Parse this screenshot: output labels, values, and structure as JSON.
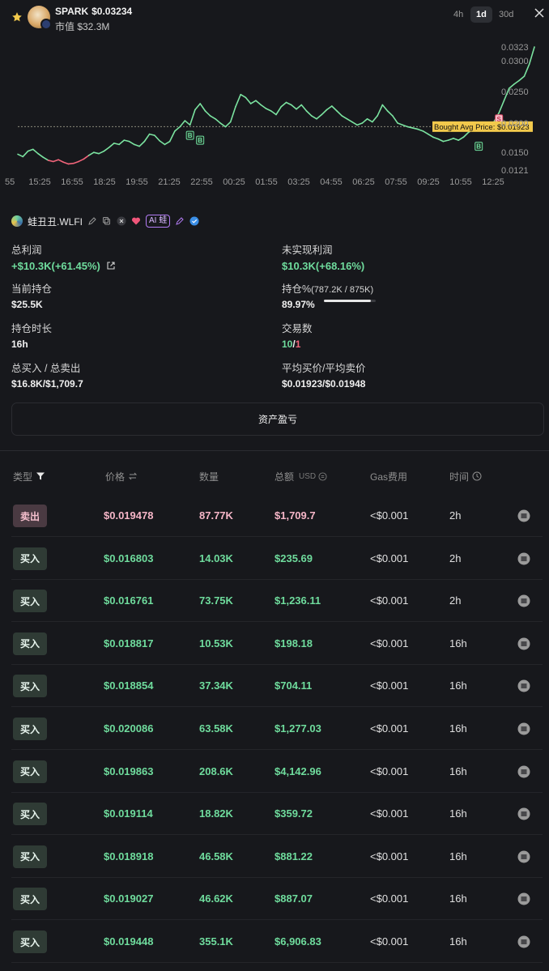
{
  "header": {
    "symbol": "SPARK",
    "price": "$0.03234",
    "mcap": "市值 $32.3M",
    "timeframes": [
      "4h",
      "1d",
      "30d"
    ],
    "active_timeframe": "1d"
  },
  "chart_data": {
    "type": "line",
    "x_ticks": [
      "55",
      "15:25",
      "16:55",
      "18:25",
      "19:55",
      "21:25",
      "22:55",
      "00:25",
      "01:55",
      "03:25",
      "04:55",
      "06:25",
      "07:55",
      "09:25",
      "10:55",
      "12:25"
    ],
    "y_ticks": [
      "0.0323",
      "0.0300",
      "0.0250",
      "0.0200",
      "0.0150",
      "0.0121"
    ],
    "ylim": [
      0.0121,
      0.0323
    ],
    "avg_line_label": "Bought Avg Price: $0.01923",
    "avg_price": 0.01923,
    "values": [
      0.0147,
      0.0143,
      0.0152,
      0.0155,
      0.0148,
      0.0142,
      0.0137,
      0.0135,
      0.0138,
      0.0134,
      0.0131,
      0.0132,
      0.0135,
      0.0139,
      0.0145,
      0.015,
      0.0148,
      0.0152,
      0.0158,
      0.0165,
      0.0163,
      0.017,
      0.0168,
      0.0163,
      0.016,
      0.0168,
      0.018,
      0.0178,
      0.0169,
      0.0163,
      0.0168,
      0.0185,
      0.0192,
      0.0202,
      0.0195,
      0.022,
      0.023,
      0.0218,
      0.021,
      0.0205,
      0.0198,
      0.0192,
      0.02,
      0.0225,
      0.0245,
      0.024,
      0.023,
      0.0235,
      0.0228,
      0.0222,
      0.0218,
      0.0212,
      0.0225,
      0.0232,
      0.0228,
      0.0221,
      0.0228,
      0.0218,
      0.021,
      0.0205,
      0.0212,
      0.022,
      0.0226,
      0.0218,
      0.021,
      0.0205,
      0.02,
      0.0195,
      0.0198,
      0.0205,
      0.02,
      0.021,
      0.0228,
      0.0218,
      0.021,
      0.0198,
      0.0195,
      0.0192,
      0.019,
      0.0188,
      0.0185,
      0.018,
      0.0175,
      0.0172,
      0.0168,
      0.017,
      0.0173,
      0.017,
      0.0175,
      0.0183,
      0.0188,
      0.0195,
      0.0185,
      0.019,
      0.02,
      0.0215,
      0.0235,
      0.0255,
      0.0262,
      0.0268,
      0.0275,
      0.0295,
      0.0323
    ],
    "markers": [
      {
        "label": "B",
        "index": 34,
        "value": 0.0178
      },
      {
        "label": "B",
        "index": 36,
        "value": 0.017
      },
      {
        "label": "B",
        "index": 91,
        "value": 0.016
      },
      {
        "label": "S",
        "index": 95,
        "value": 0.0205
      }
    ]
  },
  "wallet": {
    "name": "蛙丑丑.WLFI",
    "ai_label": "AI 蛙"
  },
  "stats": {
    "total_pnl_label": "总利润",
    "total_pnl_value": "+$10.3K(+61.45%)",
    "unrealized_label": "未实现利润",
    "unrealized_value": "$10.3K(+68.16%)",
    "holding_label": "当前持仓",
    "holding_value": "$25.5K",
    "holding_pct_label": "持仓%",
    "holding_pct_detail": "(787.2K / 875K)",
    "holding_pct_value": "89.97%",
    "holding_pct_fraction": 0.8997,
    "duration_label": "持仓时长",
    "duration_value": "16h",
    "trades_label": "交易数",
    "trades_buy": "10",
    "trades_sep": "/",
    "trades_sell": "1",
    "total_buysell_label": "总买入 / 总卖出",
    "total_buysell_value": "$16.8K/$1,709.7",
    "avg_price_label": "平均买价/平均卖价",
    "avg_price_value": "$0.01923/$0.01948"
  },
  "assets_button": "资产盈亏",
  "table": {
    "headers": {
      "type": "类型",
      "price": "价格",
      "qty": "数量",
      "total": "总额",
      "total_unit": "USD",
      "gas": "Gas费用",
      "time": "时间"
    },
    "rows": [
      {
        "side": "sell",
        "type": "卖出",
        "price": "$0.019478",
        "qty": "87.77K",
        "total": "$1,709.7",
        "gas": "<$0.001",
        "time": "2h"
      },
      {
        "side": "buy",
        "type": "买入",
        "price": "$0.016803",
        "qty": "14.03K",
        "total": "$235.69",
        "gas": "<$0.001",
        "time": "2h"
      },
      {
        "side": "buy",
        "type": "买入",
        "price": "$0.016761",
        "qty": "73.75K",
        "total": "$1,236.11",
        "gas": "<$0.001",
        "time": "2h"
      },
      {
        "side": "buy",
        "type": "买入",
        "price": "$0.018817",
        "qty": "10.53K",
        "total": "$198.18",
        "gas": "<$0.001",
        "time": "16h"
      },
      {
        "side": "buy",
        "type": "买入",
        "price": "$0.018854",
        "qty": "37.34K",
        "total": "$704.11",
        "gas": "<$0.001",
        "time": "16h"
      },
      {
        "side": "buy",
        "type": "买入",
        "price": "$0.020086",
        "qty": "63.58K",
        "total": "$1,277.03",
        "gas": "<$0.001",
        "time": "16h"
      },
      {
        "side": "buy",
        "type": "买入",
        "price": "$0.019863",
        "qty": "208.6K",
        "total": "$4,142.96",
        "gas": "<$0.001",
        "time": "16h"
      },
      {
        "side": "buy",
        "type": "买入",
        "price": "$0.019114",
        "qty": "18.82K",
        "total": "$359.72",
        "gas": "<$0.001",
        "time": "16h"
      },
      {
        "side": "buy",
        "type": "买入",
        "price": "$0.018918",
        "qty": "46.58K",
        "total": "$881.22",
        "gas": "<$0.001",
        "time": "16h"
      },
      {
        "side": "buy",
        "type": "买入",
        "price": "$0.019027",
        "qty": "46.62K",
        "total": "$887.07",
        "gas": "<$0.001",
        "time": "16h"
      },
      {
        "side": "buy",
        "type": "买入",
        "price": "$0.019448",
        "qty": "355.1K",
        "total": "$6,906.83",
        "gas": "<$0.001",
        "time": "16h"
      }
    ]
  },
  "colors": {
    "buy": "#6fdc9d",
    "sell": "#f1647a",
    "line_up": "#7be3a0",
    "line_down": "#f1647a",
    "avg_label_bg": "#f2c94c"
  }
}
